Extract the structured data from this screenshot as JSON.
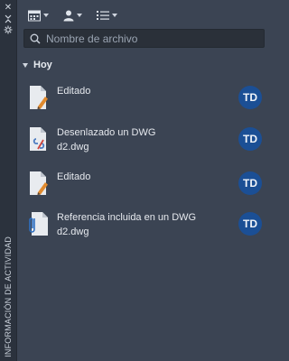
{
  "side_panel": {
    "vertical_title": "INFORMACIÓN DE ACTIVIDAD"
  },
  "toolbar": {
    "icons": [
      "calendar-grid-icon",
      "user-icon",
      "list-icon"
    ]
  },
  "search": {
    "placeholder": "Nombre de archivo",
    "value": ""
  },
  "groups": [
    {
      "label": "Hoy",
      "items": [
        {
          "icon": "edited-document-icon",
          "title": "Editado",
          "subtitle": "",
          "avatar": "TD"
        },
        {
          "icon": "detached-dwg-document-icon",
          "title": "Desenlazado un DWG",
          "subtitle": "d2.dwg",
          "avatar": "TD"
        },
        {
          "icon": "edited-document-icon",
          "title": "Editado",
          "subtitle": "",
          "avatar": "TD"
        },
        {
          "icon": "reference-attached-document-icon",
          "title": "Referencia incluida en un DWG",
          "subtitle": "d2.dwg",
          "avatar": "TD"
        }
      ]
    }
  ],
  "colors": {
    "background": "#3b4453",
    "strip": "#2b323d",
    "avatar": "#1b4f95"
  }
}
